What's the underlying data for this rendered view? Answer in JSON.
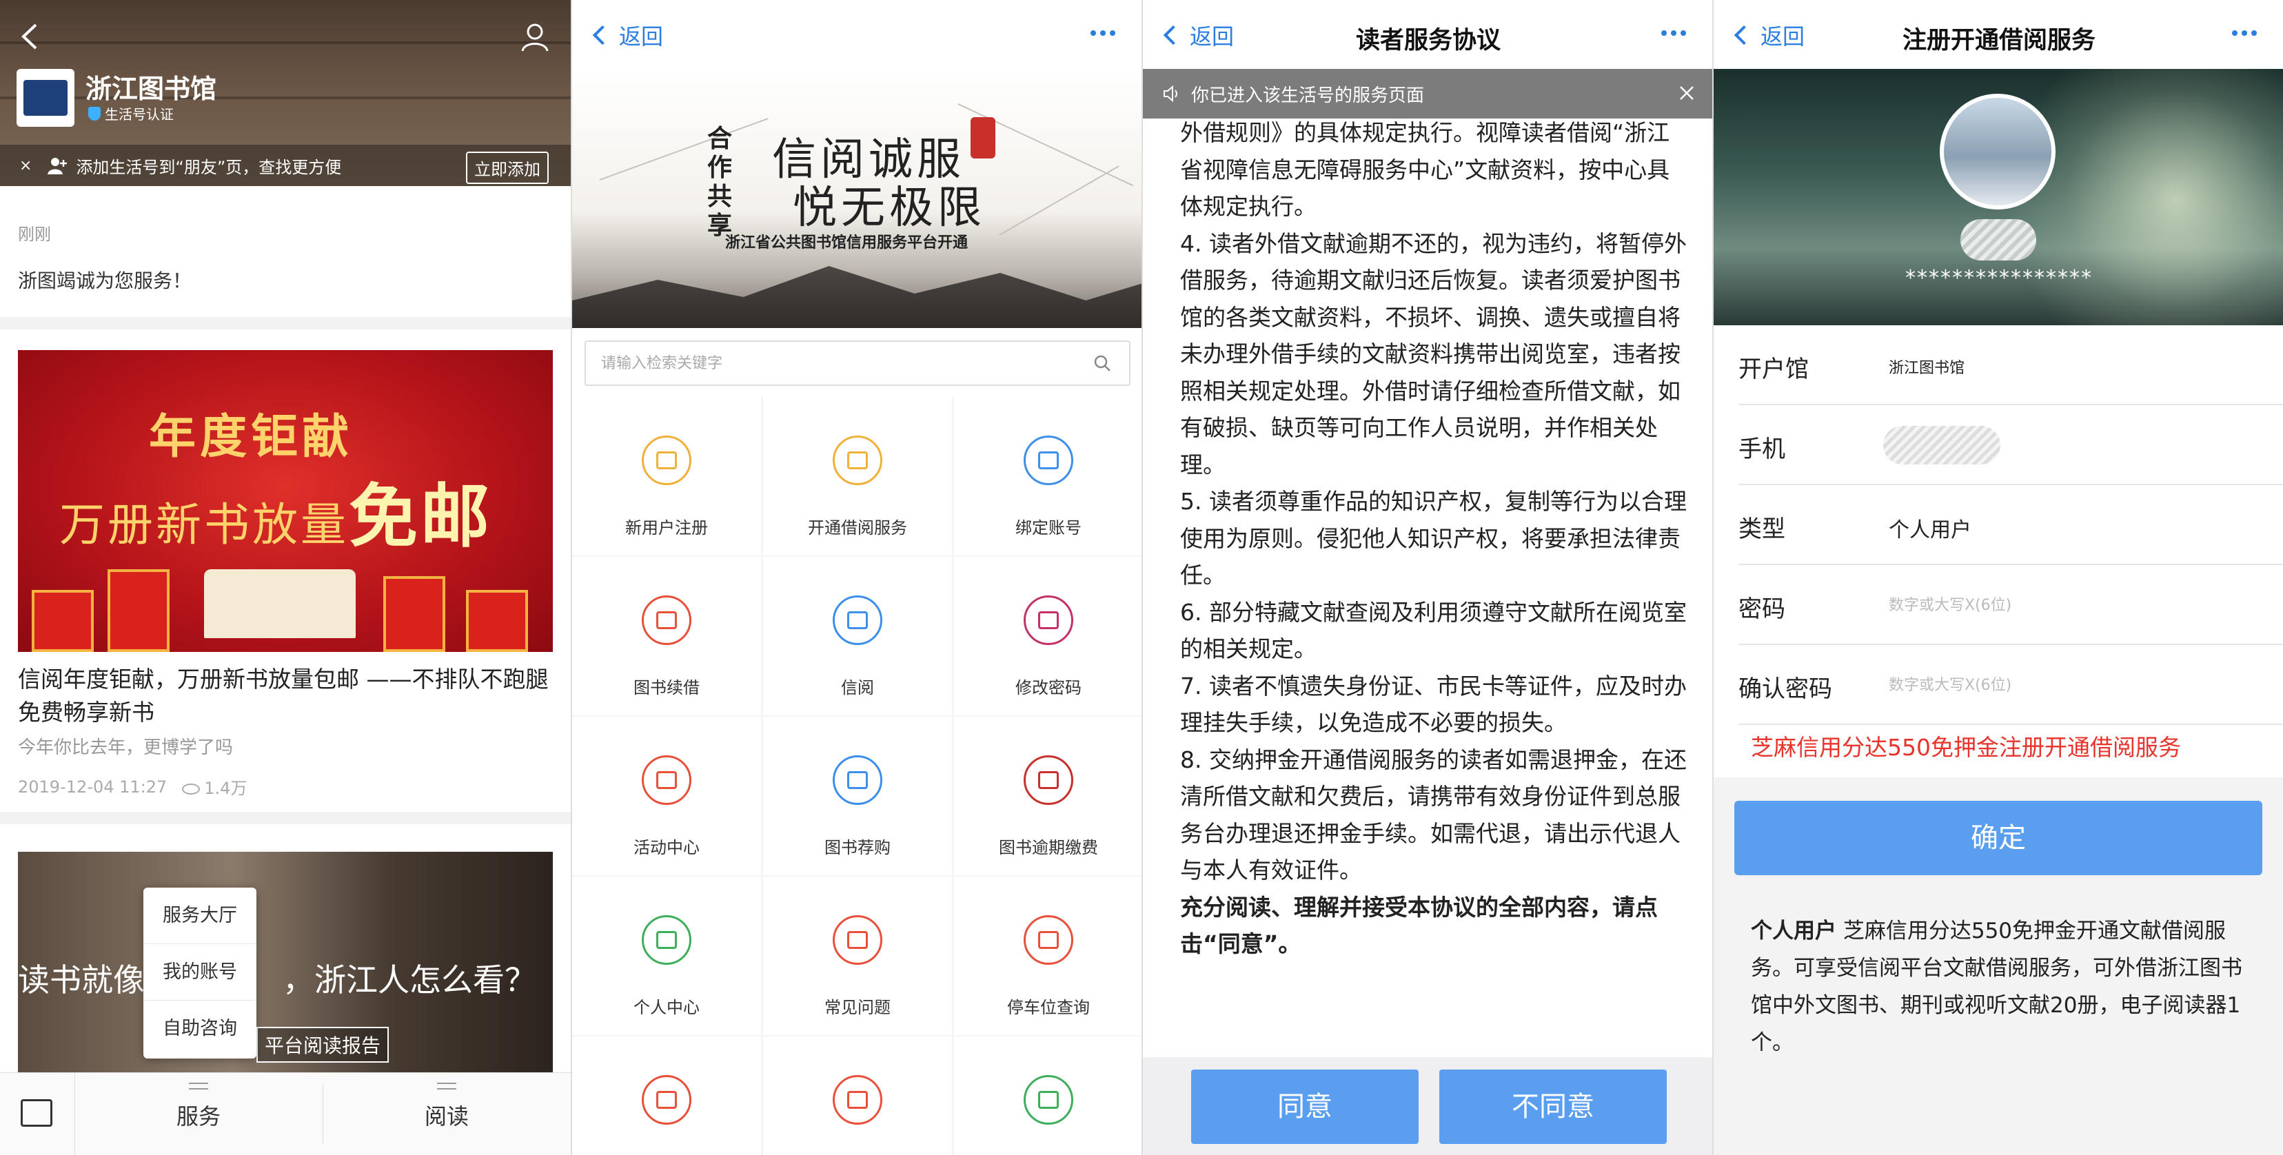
{
  "panel1": {
    "title": "浙江图书馆",
    "auth_label": "生活号认证",
    "add_bar_text": "添加生活号到“朋友”页，查找更方便",
    "add_button": "立即添加",
    "message_time": "刚刚",
    "message_text": "浙图竭诚为您服务！",
    "banner_line1": "年度钜献",
    "banner_line2": "万册新书放量",
    "banner_line2_strong": "免邮",
    "article_title": "信阅年度钜献，万册新书放量包邮 ——不排队不跑腿 免费畅享新书",
    "article_subtitle": "今年你比去年，更博学了吗",
    "article_date": "2019-12-04 11:27",
    "article_views": "1.4万",
    "photo_text": "读书就像",
    "photo_text2": "，浙江人怎么看？",
    "photo_report": "平台阅读报告",
    "popup_items": [
      "服务大厅",
      "我的账号",
      "自助咨询"
    ],
    "tabs": [
      "服务",
      "阅读"
    ]
  },
  "panel2": {
    "back_label": "返回",
    "banner_big1": "信阅诚服",
    "banner_big2": "悦无极限",
    "banner_side": "合作共享",
    "banner_sub": "浙江省公共图书馆信用服务平台开通",
    "search_placeholder": "请输入检索关键字",
    "grid": [
      {
        "label": "新用户注册",
        "color": "#f0b13a"
      },
      {
        "label": "开通借阅服务",
        "color": "#f0b13a"
      },
      {
        "label": "绑定账号",
        "color": "#3d8fe8"
      },
      {
        "label": "图书续借",
        "color": "#e8503a"
      },
      {
        "label": "信阅",
        "color": "#3d8fe8"
      },
      {
        "label": "修改密码",
        "color": "#c3306a"
      },
      {
        "label": "活动中心",
        "color": "#e8503a"
      },
      {
        "label": "图书荐购",
        "color": "#3d8fe8"
      },
      {
        "label": "图书逾期缴费",
        "color": "#c8302a"
      },
      {
        "label": "个人中心",
        "color": "#3fae5b"
      },
      {
        "label": "常见问题",
        "color": "#e8503a"
      },
      {
        "label": "停车位查询",
        "color": "#e8503a"
      },
      {
        "label": "",
        "color": "#e8503a"
      },
      {
        "label": "",
        "color": "#e8503a"
      },
      {
        "label": "",
        "color": "#3fae5b"
      }
    ]
  },
  "panel3": {
    "back_label": "返回",
    "title": "读者服务协议",
    "notice": "你已进入该生活号的服务页面",
    "paragraphs": [
      "外借规则》的具体规定执行。视障读者借阅“浙江省视障信息无障碍服务中心”文献资料，按中心具体规定执行。",
      "4. 读者外借文献逾期不还的，视为违约，将暂停外借服务，待逾期文献归还后恢复。读者须爱护图书馆的各类文献资料，不损坏、调换、遗失或擅自将未办理外借手续的文献资料携带出阅览室，违者按照相关规定处理。外借时请仔细检查所借文献，如有破损、缺页等可向工作人员说明，并作相关处理。",
      "5. 读者须尊重作品的知识产权，复制等行为以合理使用为原则。侵犯他人知识产权，将要承担法律责任。",
      "6. 部分特藏文献查阅及利用须遵守文献所在阅览室的相关规定。",
      "7. 读者不慎遗失身份证、市民卡等证件，应及时办理挂失手续，以免造成不必要的损失。",
      "8. 交纳押金开通借阅服务的读者如需退押金，在还清所借文献和欠费后，请携带有效身份证件到总服务台办理退还押金手续。如需代退，请出示代退人与本人有效证件。"
    ],
    "closing": "充分阅读、理解并接受本协议的全部内容，请点击“同意”。",
    "agree": "同意",
    "disagree": "不同意"
  },
  "panel4": {
    "back_label": "返回",
    "title": "注册开通借阅服务",
    "masked_id": "****************",
    "rows": {
      "library_label": "开户馆",
      "library_value": "浙江图书馆",
      "phone_label": "手机",
      "type_label": "类型",
      "type_value": "个人用户",
      "password_label": "密码",
      "password_placeholder": "数字或大写X(6位)",
      "confirm_label": "确认密码",
      "confirm_placeholder": "数字或大写X(6位)"
    },
    "promo": "芝麻信用分达550免押金注册开通借阅服务",
    "confirm_button": "确定",
    "desc_bold": "个人用户",
    "desc_text": " 芝麻信用分达550免押金开通文献借阅服务。可享受信阅平台文献借阅服务，可外借浙江图书馆中外文图书、期刊或视听文献20册，电子阅读器1个。"
  }
}
